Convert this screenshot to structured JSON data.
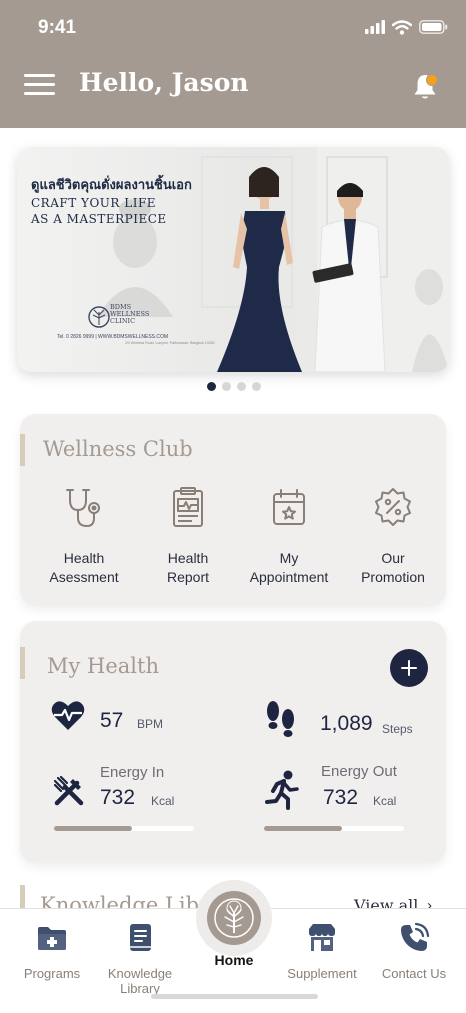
{
  "status_bar": {
    "time": "9:41"
  },
  "header": {
    "greeting": "Hello, Jason",
    "background": "#a59a91",
    "notification_color": "#f5a21a"
  },
  "banner": {
    "thai_text": "ดูแลชีวิตคุณดั่งผลงานชิ้นเอก",
    "english_text": "CRAFT YOUR LIFE\nAS A MASTERPIECE",
    "logo_text": "BDMS\nWELLNESS\nCLINIC",
    "contact": "Tel. 0 2826 9999 | WWW.BDMSWELLNESS.COM",
    "address": "2/4 Wireless Road, Lumpini, Pathumwan, Bangkok 10330",
    "slide_count": 4,
    "active_slide": 1
  },
  "wellness_club": {
    "title": "Wellness Club",
    "items": [
      {
        "label": "Health\nAsessment",
        "icon": "stethoscope-icon"
      },
      {
        "label": "Health\nReport",
        "icon": "clipboard-report-icon"
      },
      {
        "label": "My\nAppointment",
        "icon": "calendar-star-icon"
      },
      {
        "label": "Our\nPromotion",
        "icon": "discount-badge-icon"
      }
    ]
  },
  "my_health": {
    "title": "My Health",
    "heart_rate": {
      "value": "57",
      "unit": "BPM",
      "icon": "heart-pulse-icon"
    },
    "steps": {
      "value": "1,089",
      "unit": "Steps",
      "icon": "footprints-icon"
    },
    "energy_in": {
      "label": "Energy In",
      "value": "732",
      "unit": "Kcal",
      "icon": "fork-knife-icon",
      "progress": 0.56
    },
    "energy_out": {
      "label": "Energy Out",
      "value": "732",
      "unit": "Kcal",
      "icon": "running-icon",
      "progress": 0.56
    }
  },
  "knowledge_library": {
    "title": "Knowledge Library",
    "view_all": "View all"
  },
  "tab_bar": {
    "tabs": [
      {
        "label": "Programs",
        "icon": "medical-folder-icon"
      },
      {
        "label": "Knowledge\nLibrary",
        "icon": "book-icon"
      },
      {
        "label": "Home",
        "icon": "tree-logo-icon",
        "active": true
      },
      {
        "label": "Supplement",
        "icon": "store-icon"
      },
      {
        "label": "Contact Us",
        "icon": "phone-icon"
      }
    ]
  },
  "colors": {
    "navy": "#1e2540",
    "taupe": "#a59a91",
    "card": "#f1efee",
    "accent_bar": "#d7cbb9"
  }
}
